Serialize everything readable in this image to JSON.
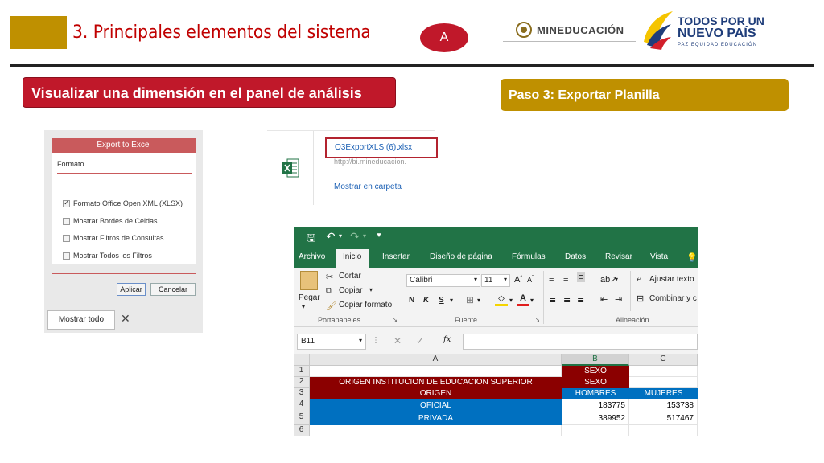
{
  "header": {
    "title": "3. Principales elementos del sistema",
    "badge": "A",
    "logos": {
      "mineducacion": "MINEDUCACIÓN",
      "tpun_line1": "TODOS POR UN",
      "tpun_line2": "NUEVO PAÍS",
      "tpun_line3": "PAZ  EQUIDAD  EDUCACIÓN"
    }
  },
  "banners": {
    "left": "Visualizar una dimensión en el panel de análisis",
    "right": "Paso 3: Exportar Planilla"
  },
  "export_dialog": {
    "title": "Export to Excel",
    "section_label": "Formato",
    "options": [
      {
        "label": "Formato Office Open XML (XLSX)",
        "checked": true
      },
      {
        "label": "Mostrar Bordes de Celdas",
        "checked": false
      },
      {
        "label": "Mostrar Filtros de Consultas",
        "checked": false
      },
      {
        "label": "Mostrar Todos los Filtros",
        "checked": false
      }
    ],
    "apply_label": "Aplicar",
    "cancel_label": "Cancelar",
    "show_all_label": "Mostrar todo"
  },
  "download": {
    "filename": "O3ExportXLS (6).xlsx",
    "url": "http://bi.mineducacion.",
    "folder_link": "Mostrar en carpeta"
  },
  "excel": {
    "tabs": [
      "Archivo",
      "Inicio",
      "Insertar",
      "Diseño de página",
      "Fórmulas",
      "Datos",
      "Revisar",
      "Vista"
    ],
    "active_tab": "Inicio",
    "clipboard": {
      "paste": "Pegar",
      "cut": "Cortar",
      "copy": "Copiar",
      "format_painter": "Copiar formato",
      "group": "Portapapeles"
    },
    "font": {
      "name": "Calibri",
      "size": "11",
      "bold": "N",
      "italic": "K",
      "underline": "S",
      "group": "Fuente"
    },
    "alignment": {
      "wrap": "Ajustar texto",
      "merge": "Combinar y c",
      "group": "Alineación"
    },
    "name_box": "B11",
    "formula_symbol": "fx",
    "columns": [
      "A",
      "B",
      "C"
    ],
    "rows": [
      "1",
      "2",
      "3",
      "4",
      "5",
      "6"
    ],
    "cells": {
      "b1": "SEXO",
      "a2": "ORIGEN INSTITUCION DE EDUCACION SUPERIOR",
      "b2": "SEXO",
      "a3": "ORIGEN",
      "b3": "HOMBRES",
      "c3": "MUJERES",
      "a4": "OFICIAL",
      "b4": "183775",
      "c4": "153738",
      "a5": "PRIVADA",
      "b5": "389952",
      "c5": "517467"
    }
  },
  "colors": {
    "accent_gold": "#bf9000",
    "accent_red": "#c0182a",
    "excel_green": "#217346",
    "dark_red_cell": "#8b0000",
    "blue_cell": "#0070c0"
  }
}
